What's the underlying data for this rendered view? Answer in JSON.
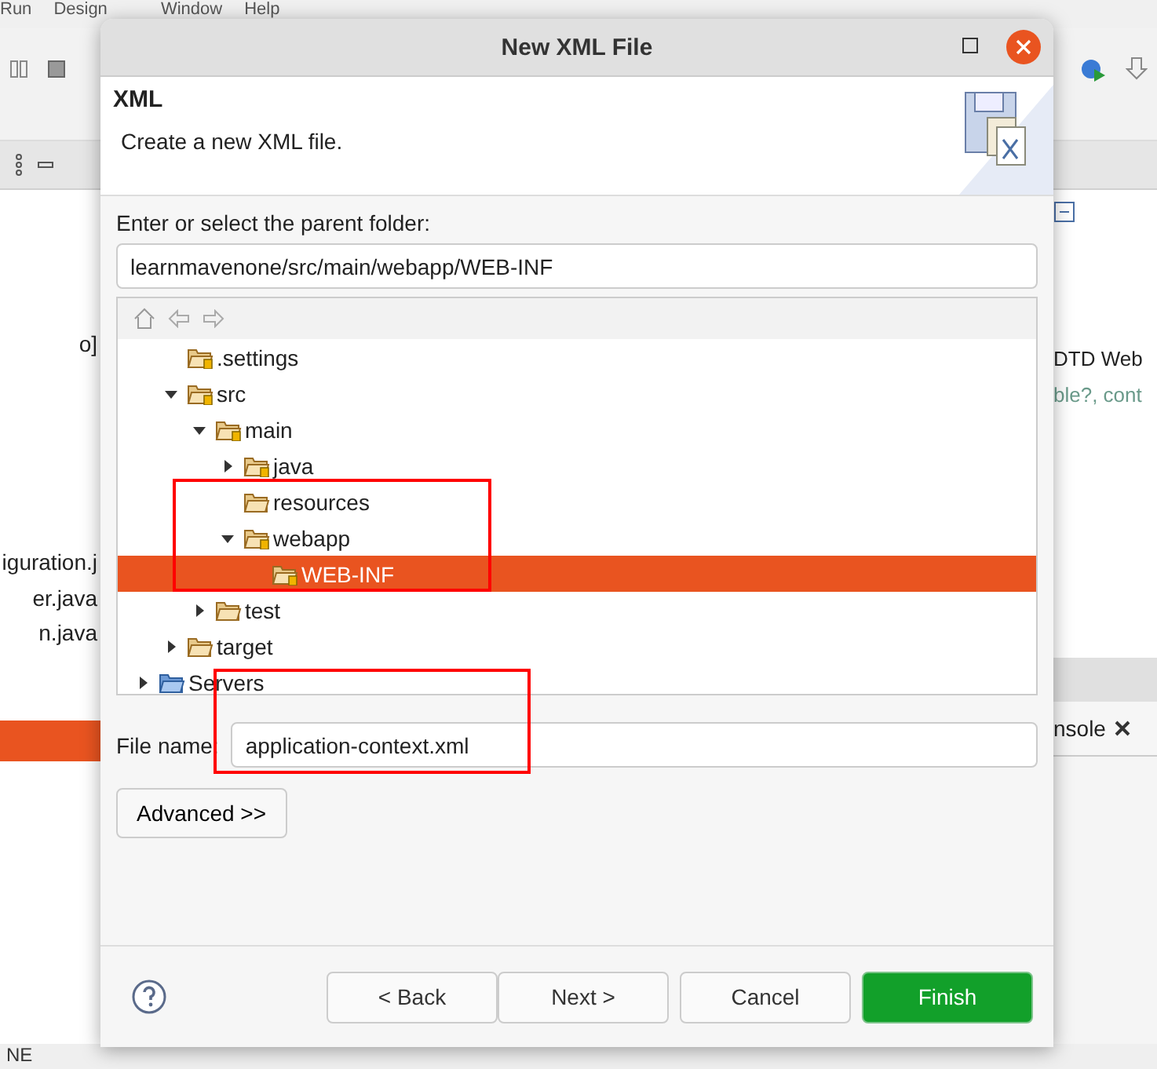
{
  "ide": {
    "menus": [
      "Run",
      "Design",
      "Window",
      "Help"
    ],
    "left_panel": {
      "lines": [
        "o]",
        "iguration.j",
        "er.java",
        "n.java"
      ]
    },
    "right_panel": {
      "lines": [
        {
          "text": "DTD Web",
          "kind": "plain"
        },
        {
          "text": "ble?, cont",
          "kind": "attribute"
        }
      ],
      "console_tab": "nsole"
    },
    "status_bar": "NE"
  },
  "dialog": {
    "title": "New XML File",
    "header": {
      "title": "XML",
      "description": "Create a new XML file."
    },
    "folder_label": "Enter or select the parent folder:",
    "folder_path": "learnmavenone/src/main/webapp/WEB-INF",
    "tree": [
      {
        "children": [
          {
            "label": ".settings",
            "kind": "source",
            "selected": false
          },
          {
            "label": "src",
            "kind": "source",
            "expanded": true,
            "selected": false,
            "children": [
              {
                "label": "main",
                "kind": "source",
                "expanded": true,
                "selected": false,
                "children": [
                  {
                    "label": "java",
                    "kind": "source",
                    "expanded": false,
                    "selected": false
                  },
                  {
                    "label": "resources",
                    "kind": "folder",
                    "selected": false
                  },
                  {
                    "label": "webapp",
                    "kind": "source",
                    "expanded": true,
                    "selected": false,
                    "children": [
                      {
                        "label": "WEB-INF",
                        "kind": "source",
                        "selected": true
                      }
                    ]
                  }
                ]
              },
              {
                "label": "test",
                "kind": "folder",
                "expanded": false,
                "selected": false
              }
            ]
          },
          {
            "label": "target",
            "kind": "folder",
            "expanded": false,
            "selected": false
          }
        ]
      },
      {
        "label": "Servers",
        "kind": "servers",
        "expanded": false,
        "selected": false
      }
    ],
    "file_name_label": "File name:",
    "file_name": "application-context.xml",
    "advanced_button": "Advanced >>",
    "buttons": [
      {
        "label": "< Back",
        "kind": "normal"
      },
      {
        "label": "Next >",
        "kind": "normal"
      },
      {
        "label": "Cancel",
        "kind": "normal"
      },
      {
        "label": "Finish",
        "kind": "default"
      }
    ]
  }
}
